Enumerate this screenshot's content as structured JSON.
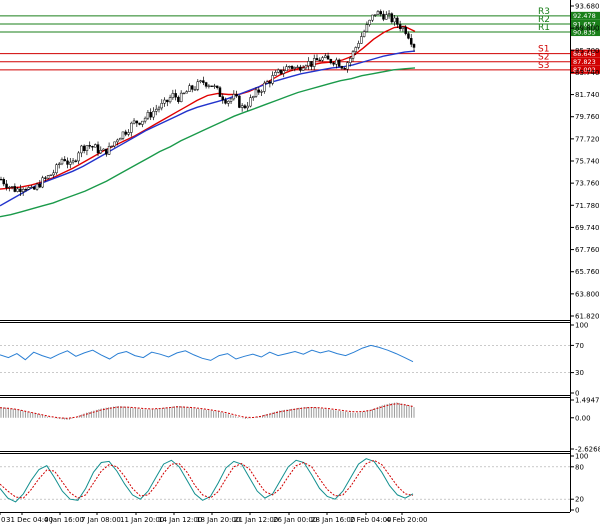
{
  "chart_data": [
    {
      "type": "candlestick",
      "price_axis": {
        "range": [
          61.82,
          93.68
        ],
        "ticks": [
          "93.680",
          "89.800",
          "85.700",
          "83.740",
          "81.740",
          "79.760",
          "77.720",
          "75.740",
          "73.760",
          "71.780",
          "69.740",
          "67.760",
          "65.760",
          "63.800",
          "61.820"
        ]
      },
      "x_labels": [
        "0",
        "31 Dec 04:00",
        "4 Jan 16:00",
        "7 Jan 08:00",
        "11 Jan 20:00",
        "14 Jan 12:00",
        "18 Jan 20:00",
        "21 Jan 12:00",
        "26 Jan 00:00",
        "28 Jan 16:00",
        "2 Feb 04:00",
        "4 Feb 20:00"
      ],
      "levels": [
        {
          "name": "R3",
          "value": 92.478,
          "tag": "92.478",
          "color": "#1a7f1a"
        },
        {
          "name": "R2",
          "value": 91.657,
          "tag": "91.657",
          "color": "#1a7f1a"
        },
        {
          "name": "R1",
          "value": 90.835,
          "tag": "90.835",
          "color": "#1a7f1a"
        },
        {
          "name": "S1",
          "value": 88.645,
          "tag": "88.645",
          "color": "#d00000"
        },
        {
          "name": "S2",
          "value": 87.823,
          "tag": "87.823",
          "color": "#d00000"
        },
        {
          "name": "S3",
          "value": 87.002,
          "tag": "87.002",
          "color": "#d00000"
        }
      ],
      "price_path": [
        75.9,
        75.2,
        74.8,
        75.3,
        74.6,
        75.5,
        76.1,
        76.8,
        78.2,
        77.1,
        78.9,
        79.4,
        79.1,
        78.6,
        79.0,
        80.2,
        80.8,
        81.6,
        81.9,
        82.4,
        83.1,
        83.5,
        84.4,
        84.1,
        84.9,
        85.3,
        85.8,
        85.5,
        84.6,
        83.9,
        84.2,
        83.1,
        83.9,
        84.8,
        85.6,
        86.3,
        86.9,
        87.4,
        87.1,
        87.8,
        87.6,
        88.2,
        87.9,
        88.0,
        87.3,
        88.4,
        90.1,
        91.4,
        92.8,
        92.6,
        92.2,
        91.6,
        91.0,
        89.5
      ],
      "overlays": [
        {
          "color": "#e00000",
          "values": [
            74.9,
            75.0,
            75.1,
            75.3,
            75.6,
            76.0,
            76.5,
            77.0,
            77.6,
            78.2,
            78.8,
            79.3,
            79.8,
            80.3,
            80.9,
            81.5,
            82.1,
            82.7,
            83.3,
            83.9,
            84.4,
            84.6,
            84.5,
            84.5,
            84.8,
            85.3,
            85.9,
            86.5,
            86.9,
            87.2,
            87.5,
            87.7,
            87.8,
            88.0,
            88.4,
            89.2,
            90.1,
            90.8,
            91.3,
            91.4,
            90.9
          ]
        },
        {
          "color": "#2233cc",
          "values": [
            73.2,
            73.8,
            74.4,
            75.0,
            75.5,
            75.9,
            76.3,
            76.7,
            77.2,
            77.8,
            78.4,
            79.0,
            79.6,
            80.2,
            80.8,
            81.3,
            81.8,
            82.3,
            82.8,
            83.2,
            83.5,
            83.8,
            84.1,
            84.5,
            84.9,
            85.3,
            85.7,
            86.0,
            86.3,
            86.6,
            86.8,
            87.0,
            87.2,
            87.3,
            87.5,
            87.8,
            88.1,
            88.4,
            88.6,
            88.8,
            88.9
          ]
        },
        {
          "color": "#1a9a4a",
          "values": [
            72.1,
            72.3,
            72.6,
            72.9,
            73.2,
            73.5,
            73.9,
            74.3,
            74.7,
            75.2,
            75.7,
            76.3,
            76.9,
            77.5,
            78.1,
            78.7,
            79.2,
            79.8,
            80.3,
            80.8,
            81.3,
            81.8,
            82.3,
            82.7,
            83.1,
            83.5,
            83.9,
            84.3,
            84.7,
            85.0,
            85.3,
            85.6,
            85.9,
            86.1,
            86.4,
            86.6,
            86.8,
            87.0,
            87.1,
            87.2
          ]
        }
      ]
    },
    {
      "type": "line",
      "indicator": "oscillator",
      "ylim": [
        0,
        100
      ],
      "ticks": [
        "100",
        "70",
        "30",
        "0"
      ],
      "series": [
        {
          "color": "#2a7fd4",
          "values": [
            56,
            52,
            58,
            49,
            60,
            55,
            51,
            57,
            62,
            54,
            59,
            63,
            56,
            50,
            58,
            61,
            55,
            52,
            60,
            57,
            53,
            59,
            62,
            56,
            51,
            48,
            55,
            58,
            50,
            54,
            57,
            53,
            60,
            55,
            58,
            61,
            57,
            63,
            59,
            62,
            58,
            55,
            60,
            66,
            70,
            67,
            63,
            58,
            52,
            46
          ]
        }
      ]
    },
    {
      "type": "bar",
      "indicator": "histogram",
      "ylim": [
        -2.6268,
        1.4947
      ],
      "ticks": [
        "1.4947",
        "0.00",
        "-2.6268"
      ],
      "values": [
        0.9,
        0.8,
        0.7,
        0.5,
        0.4,
        0.2,
        0.0,
        -0.1,
        -0.2,
        0.1,
        0.4,
        0.6,
        0.8,
        0.9,
        1.0,
        0.9,
        0.8,
        0.7,
        0.7,
        0.8,
        0.9,
        1.0,
        0.9,
        0.8,
        0.7,
        0.6,
        0.5,
        0.3,
        0.1,
        -0.1,
        0.0,
        0.2,
        0.4,
        0.6,
        0.7,
        0.8,
        0.9,
        0.9,
        0.8,
        0.7,
        0.6,
        0.5,
        0.4,
        0.5,
        0.7,
        1.0,
        1.2,
        1.3,
        1.1,
        0.9
      ],
      "signal": [
        0.85,
        0.8,
        0.7,
        0.55,
        0.4,
        0.25,
        0.1,
        0.0,
        -0.05,
        0.05,
        0.25,
        0.45,
        0.65,
        0.8,
        0.9,
        0.9,
        0.85,
        0.78,
        0.74,
        0.78,
        0.85,
        0.92,
        0.9,
        0.85,
        0.76,
        0.66,
        0.55,
        0.4,
        0.22,
        0.05,
        0.02,
        0.12,
        0.3,
        0.48,
        0.6,
        0.72,
        0.82,
        0.86,
        0.84,
        0.77,
        0.68,
        0.58,
        0.5,
        0.52,
        0.64,
        0.85,
        1.05,
        1.18,
        1.1,
        0.95
      ]
    },
    {
      "type": "line",
      "indicator": "stochastic",
      "ylim": [
        0,
        100
      ],
      "ticks": [
        "100",
        "80",
        "20",
        "0"
      ],
      "series": [
        {
          "color": "#138f8f",
          "values": [
            40,
            22,
            15,
            30,
            55,
            75,
            82,
            60,
            35,
            20,
            18,
            40,
            70,
            88,
            90,
            72,
            48,
            28,
            20,
            35,
            60,
            85,
            92,
            80,
            55,
            30,
            18,
            25,
            50,
            78,
            90,
            85,
            60,
            35,
            22,
            30,
            55,
            80,
            92,
            88,
            65,
            40,
            25,
            20,
            35,
            60,
            85,
            95,
            90,
            70,
            45,
            28,
            22,
            30
          ]
        },
        {
          "color": "#d00000",
          "values": [
            48,
            35,
            24,
            22,
            38,
            58,
            74,
            72,
            52,
            32,
            22,
            28,
            50,
            72,
            84,
            80,
            62,
            40,
            26,
            28,
            45,
            68,
            85,
            86,
            70,
            46,
            28,
            22,
            34,
            58,
            80,
            86,
            76,
            54,
            34,
            28,
            40,
            62,
            82,
            88,
            80,
            58,
            38,
            26,
            28,
            44,
            66,
            86,
            92,
            84,
            64,
            44,
            30,
            27
          ]
        }
      ]
    }
  ]
}
